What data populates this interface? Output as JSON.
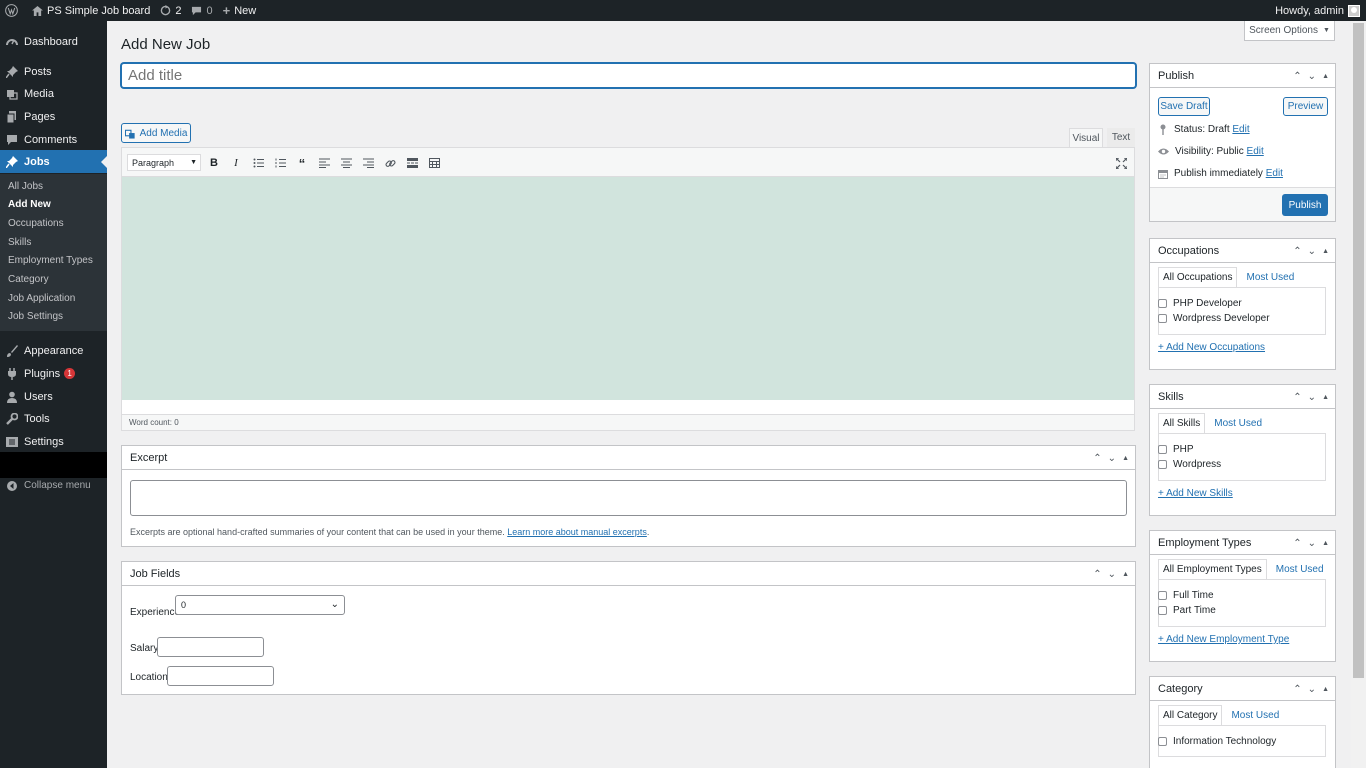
{
  "adminbar": {
    "site_name": "PS Simple Job board",
    "updates": "2",
    "comments": "0",
    "new_label": "New",
    "howdy": "Howdy, admin"
  },
  "menu": {
    "dashboard": "Dashboard",
    "posts": "Posts",
    "media": "Media",
    "pages": "Pages",
    "comments": "Comments",
    "jobs": "Jobs",
    "sub": [
      "All Jobs",
      "Add New",
      "Occupations",
      "Skills",
      "Employment Types",
      "Category",
      "Job Application",
      "Job Settings"
    ],
    "appearance": "Appearance",
    "plugins": "Plugins",
    "plugins_badge": "1",
    "users": "Users",
    "tools": "Tools",
    "settings": "Settings",
    "collapse": "Collapse menu"
  },
  "screen_options": "Screen Options",
  "page_title": "Add New Job",
  "title_placeholder": "Add title",
  "editor": {
    "add_media": "Add Media",
    "tab_visual": "Visual",
    "tab_text": "Text",
    "format_select": "Paragraph",
    "word_count": "Word count: 0"
  },
  "excerpt": {
    "title": "Excerpt",
    "help": "Excerpts are optional hand-crafted summaries of your content that can be used in your theme.",
    "link": "Learn more about manual excerpts",
    "period": "."
  },
  "job_fields": {
    "title": "Job Fields",
    "experience_label": "Experience",
    "experience_value": "0",
    "salary_label": "Salary",
    "location_label": "Location"
  },
  "publish": {
    "title": "Publish",
    "save_draft": "Save Draft",
    "preview": "Preview",
    "status_label": "Status:",
    "status_value": "Draft",
    "visibility_label": "Visibility:",
    "visibility_value": "Public",
    "schedule": "Publish immediately",
    "edit": "Edit",
    "publish_btn": "Publish"
  },
  "occupations": {
    "title": "Occupations",
    "tab_all": "All Occupations",
    "tab_most": "Most Used",
    "items": [
      "PHP Developer",
      "Wordpress Developer"
    ],
    "add_new": "+ Add New Occupations"
  },
  "skills": {
    "title": "Skills",
    "tab_all": "All Skills",
    "tab_most": "Most Used",
    "items": [
      "PHP",
      "Wordpress"
    ],
    "add_new": "+ Add New Skills"
  },
  "employment": {
    "title": "Employment Types",
    "tab_all": "All Employment Types",
    "tab_most": "Most Used",
    "items": [
      "Full Time",
      "Part Time"
    ],
    "add_new": "+ Add New Employment Type"
  },
  "category": {
    "title": "Category",
    "tab_all": "All Category",
    "tab_most": "Most Used",
    "items": [
      "Information Technology"
    ]
  },
  "colors": {
    "adminbar": "#1d2327",
    "accent": "#2271b1",
    "editor_bg": "#d1e4dd"
  }
}
